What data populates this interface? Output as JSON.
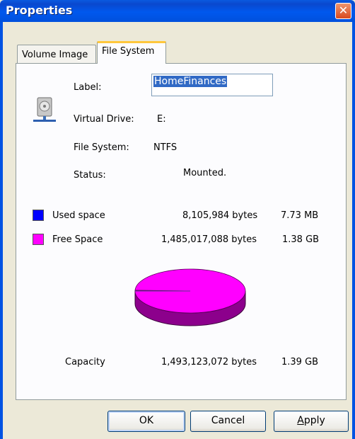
{
  "window": {
    "title": "Properties",
    "close_glyph": "✕"
  },
  "tabs": [
    {
      "label": "Volume Image"
    },
    {
      "label": "File System"
    }
  ],
  "fields": {
    "label_caption": "Label:",
    "label_value": "HomeFinances",
    "virtual_drive_caption": "Virtual Drive:",
    "virtual_drive_value": "E:",
    "file_system_caption": "File System:",
    "file_system_value": "NTFS",
    "status_caption": "Status:",
    "status_value": "Mounted."
  },
  "usage": {
    "used": {
      "label": "Used space",
      "bytes": "8,105,984 bytes",
      "size": "7.73 MB",
      "color": "#0000FF"
    },
    "free": {
      "label": "Free Space",
      "bytes": "1,485,017,088 bytes",
      "size": "1.38 GB",
      "color": "#FF00FF"
    },
    "capacity": {
      "label": "Capacity",
      "bytes": "1,493,123,072 bytes",
      "size": "1.39 GB"
    }
  },
  "chart_data": {
    "type": "pie",
    "categories": [
      "Used space",
      "Free Space"
    ],
    "values": [
      8105984,
      1485017088
    ],
    "colors": [
      "#0000FF",
      "#FF00FF"
    ]
  },
  "buttons": {
    "ok": "OK",
    "cancel": "Cancel",
    "apply": "Apply"
  },
  "icons": {
    "drive": "hard-drive-icon"
  }
}
